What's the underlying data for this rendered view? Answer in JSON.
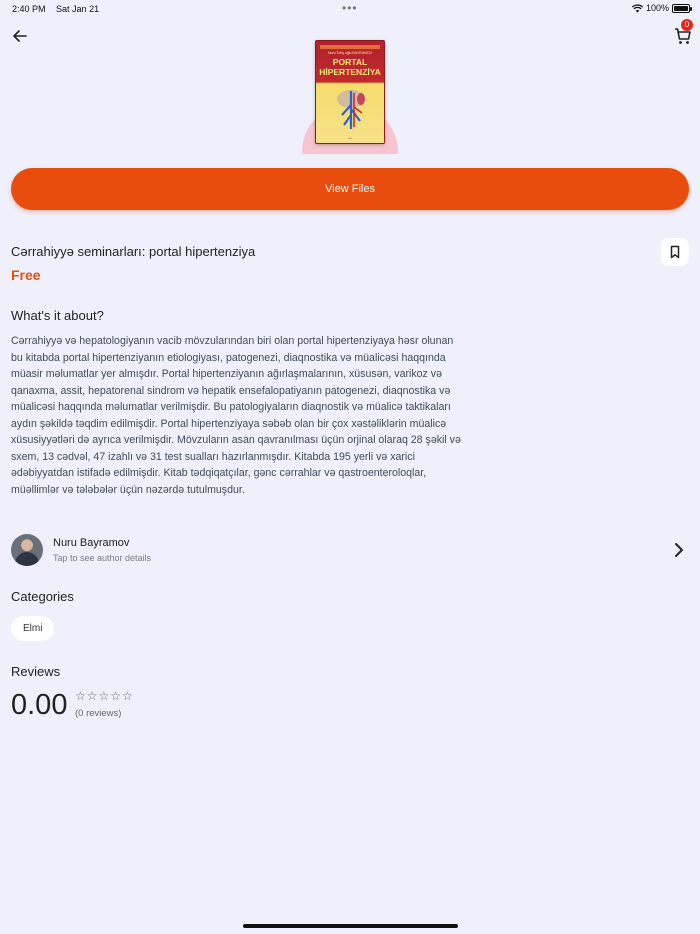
{
  "status_bar": {
    "time": "2:40 PM",
    "date": "Sat Jan 21",
    "dots": "•••",
    "battery": "100%"
  },
  "header": {
    "cart_count": "0"
  },
  "cover": {
    "author": "Nuru Tofiq oğlu BAYRAMOV",
    "title_line1": "PORTAL",
    "title_line2": "HİPERTENZİYA",
    "colors": {
      "red": "#b1222b",
      "yellow": "#f7e189"
    }
  },
  "actions": {
    "view_files_label": "View Files"
  },
  "book": {
    "title": "Cərrahiyyə seminarları: portal hipertenziya",
    "price": "Free"
  },
  "about": {
    "heading": "What's it about?",
    "text": "Cərrahiyyə və hepatologiyanın vacib mövzularından biri olan portal hipertenziyaya həsr olunan bu kitabda portal hipertenziyanın etiologiyası, patogenezi, diaqnostika və müalicəsi haqqında müasir məlumatlar yer almışdır. Portal hipertenziyanın ağırlaşmalarının, xüsusən, varikoz və qanaxma, assit, hepatorenal sindrom və hepatik ensefalopatiyanın patogenezi, diaqnostika və müalicəsi haqqında məlumatlar verilmişdir. Bu patologiyaların diaqnostik və müalicə taktikaları aydın şəkildə təqdim edilmişdir. Portal hipertenziyaya səbəb olan bir çox xəstəliklərin müalicə xüsusiyyətləri də ayrıca verilmişdir. Mövzuların asan qavranılması üçün orjinal olaraq 28 şəkil və sxem, 13 cədvəl, 47 izahlı və 31 test sualları hazırlanmışdır. Kitabda 195 yerli və xarici ədəbiyyatdan istifadə edilmişdir. Kitab tədqiqatçılar, gənc cərrahlar və qastroenteroloqlar, müəllimlər və tələbələr üçün nəzərdə tutulmuşdur."
  },
  "author": {
    "name": "Nuru Bayramov",
    "subtitle": "Tap to see author details"
  },
  "categories": {
    "heading": "Categories",
    "items": [
      "Elmi"
    ]
  },
  "reviews": {
    "heading": "Reviews",
    "rating": "0.00",
    "stars": "☆☆☆☆☆",
    "count_label": "(0 reviews)"
  },
  "colors": {
    "accent": "#e84d0e",
    "background": "#eff0fb",
    "badge": "#e8231a"
  }
}
